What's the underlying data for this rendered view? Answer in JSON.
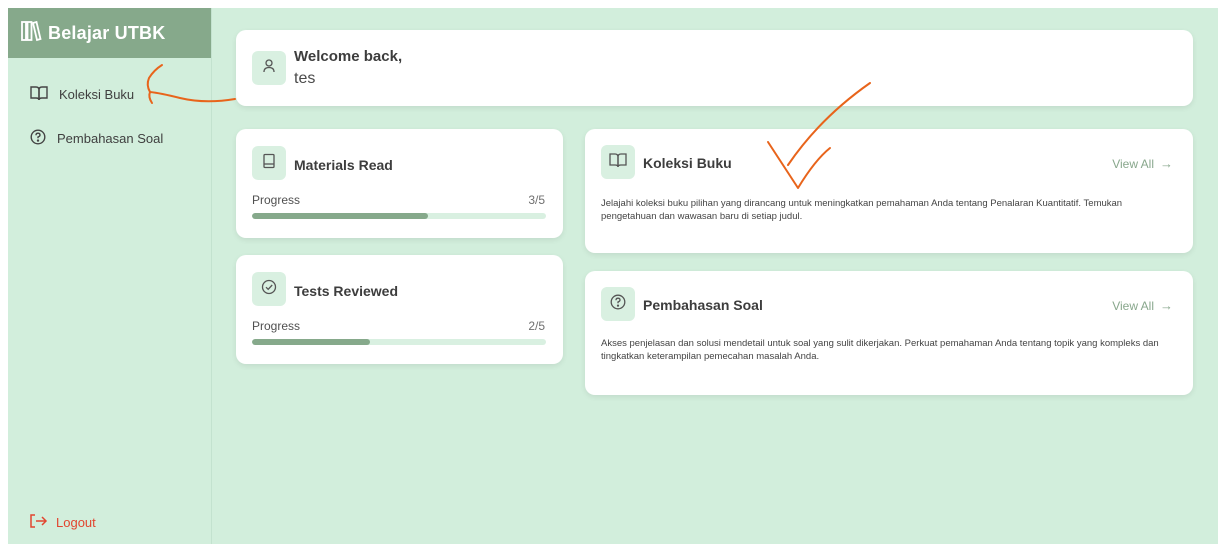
{
  "sidebar": {
    "brand": "Belajar UTBK",
    "items": [
      {
        "label": "Koleksi Buku"
      },
      {
        "label": "Pembahasan Soal"
      }
    ],
    "logout": "Logout"
  },
  "welcome": {
    "title": "Welcome back,",
    "user": "tes"
  },
  "stats": {
    "materials": {
      "title": "Materials Read",
      "progress_label": "Progress",
      "value": "3/5",
      "fraction": 0.6
    },
    "tests": {
      "title": "Tests Reviewed",
      "progress_label": "Progress",
      "value": "2/5",
      "fraction": 0.4
    }
  },
  "features": {
    "koleksi": {
      "title": "Koleksi Buku",
      "link": "View All",
      "desc": "Jelajahi koleksi buku pilihan yang dirancang untuk meningkatkan pemahaman Anda tentang Penalaran Kuantitatif. Temukan pengetahuan dan wawasan baru di setiap judul."
    },
    "pembahasan": {
      "title": "Pembahasan Soal",
      "link": "View All",
      "desc": "Akses penjelasan dan solusi mendetail untuk soal yang sulit dikerjakan. Perkuat pemahaman Anda tentang topik yang kompleks dan tingkatkan keterampilan pemecahan masalah Anda."
    }
  },
  "colors": {
    "background": "#d2eedc",
    "brand": "#86a98b",
    "accent": "#86a98b",
    "logout": "#e2452f",
    "annotation": "#e8641b"
  },
  "icons": {
    "brand": "books-icon",
    "koleksi": "book-open-icon",
    "pembahasan": "question-circle-icon",
    "logout": "logout-icon",
    "user": "user-icon",
    "materials": "book-icon",
    "tests": "check-circle-icon",
    "arrow": "arrow-right-icon"
  }
}
